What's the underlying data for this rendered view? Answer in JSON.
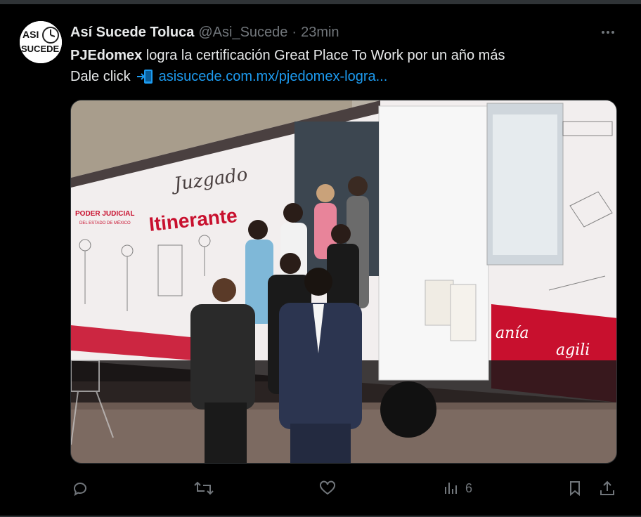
{
  "tweet": {
    "author_name": "Así Sucede Toluca",
    "author_handle": "@Asi_Sucede",
    "separator": "·",
    "time": "23min",
    "avatar_logo_text": [
      "ASI",
      "SUCEDE"
    ],
    "text_bold": "PJEdomex",
    "text_rest": " logra la certificación Great Place To Work por un año más",
    "link_prefix": "Dale click",
    "link_text": "asisucede.com.mx/pjedomex-logra..."
  },
  "media": {
    "truck_signage": {
      "org": "PODER JUDICIAL",
      "org_sub": "DEL ESTADO DE MÉXICO",
      "title_line1": "Juzgado",
      "title_line2": "Itinerante",
      "side_words_1": "anía",
      "side_words_2": "agili"
    }
  },
  "actions": {
    "views_count": "6"
  },
  "colors": {
    "background": "#000000",
    "text": "#e7e9ea",
    "muted": "#71767b",
    "link": "#1d9bf0",
    "brand_red": "#c8102e"
  },
  "icons": [
    "more-icon",
    "reply-icon",
    "retweet-icon",
    "like-icon",
    "views-icon",
    "bookmark-icon",
    "share-icon",
    "mobile-arrow-icon"
  ]
}
